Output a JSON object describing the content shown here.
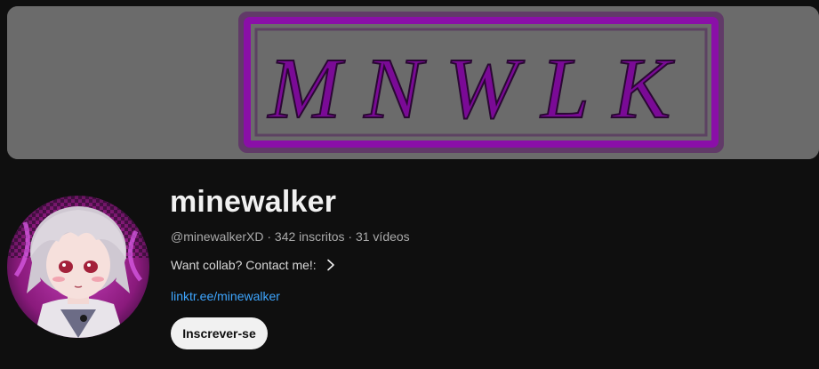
{
  "banner": {
    "logo_text": "MNWLK",
    "background_color": "#6b6b6b",
    "accent_color": "#8a0fa8"
  },
  "channel": {
    "name": "minewalker",
    "handle": "@minewalkerXD",
    "subscribers": "342 inscritos",
    "videos": "31 vídeos",
    "meta_separator": " · ",
    "meta_line": "@minewalkerXD · 342 inscritos · 31 vídeos",
    "description": "Want collab? Contact me!:",
    "link": "linktr.ee/minewalker",
    "subscribe_label": "Inscrever-se"
  },
  "icons": {
    "description_expand": "chevron-right-icon",
    "avatar": "avatar-image"
  },
  "colors": {
    "page_background": "#0f0f0f",
    "link": "#3ea6ff",
    "subscribe_bg": "#f1f1f1",
    "muted_text": "#aaaaaa"
  }
}
